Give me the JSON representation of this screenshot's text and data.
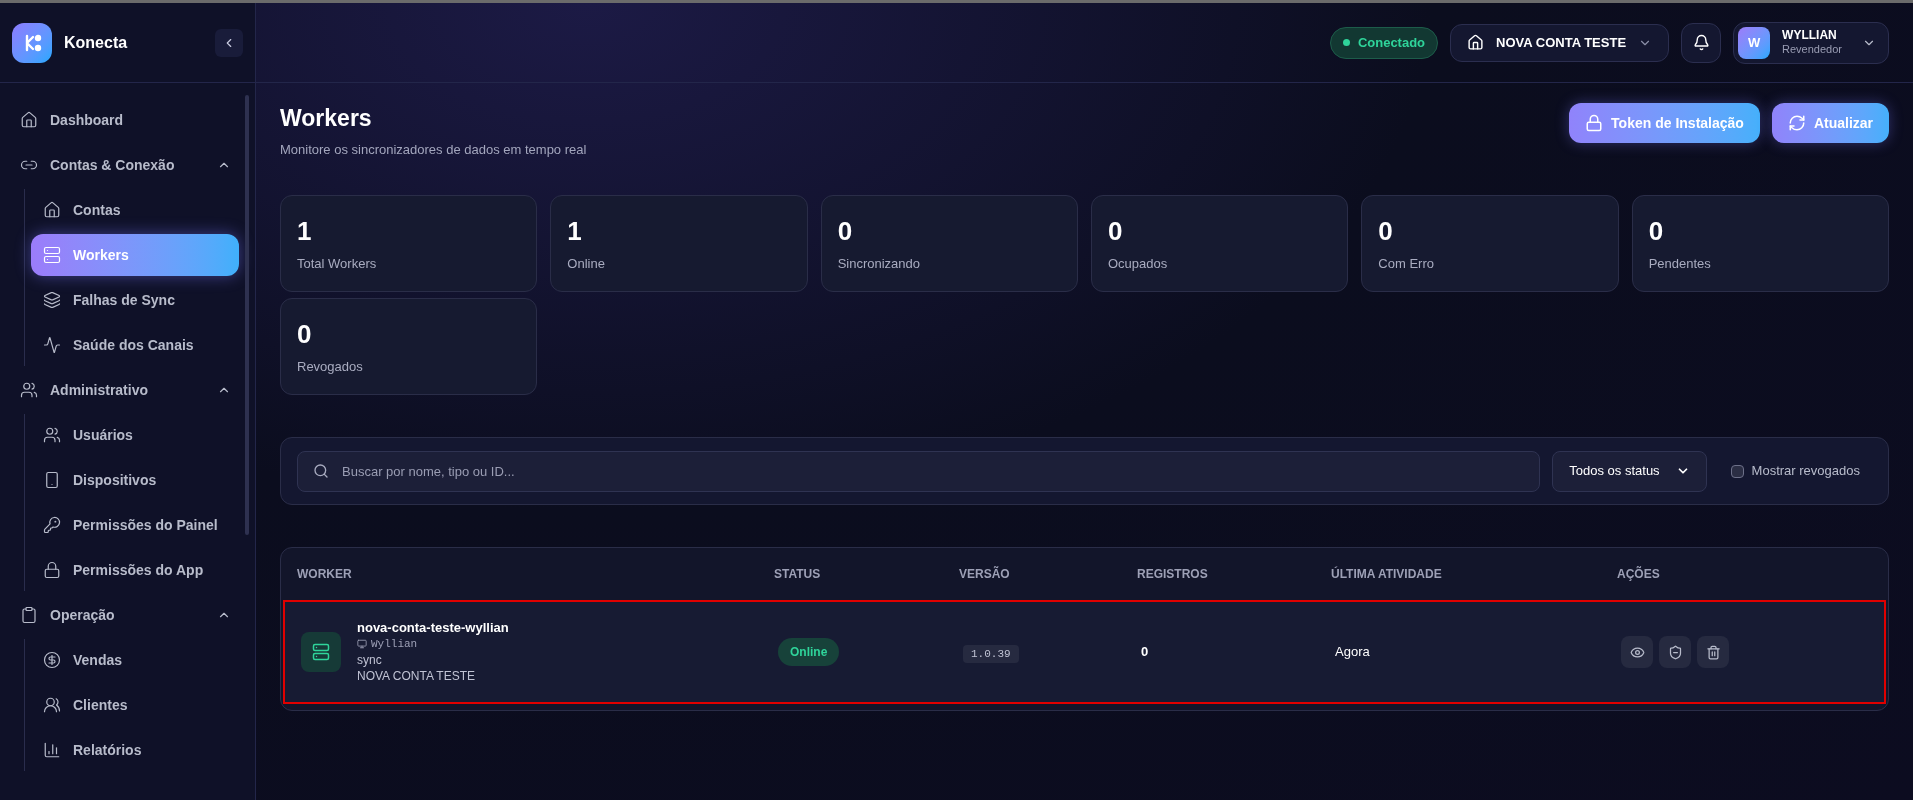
{
  "brand": {
    "name": "Konecta"
  },
  "sidebar": {
    "items": [
      {
        "label": "Dashboard",
        "selected": false
      },
      {
        "label": "Contas & Conexão",
        "expanded": true,
        "children": [
          {
            "label": "Contas",
            "selected": false
          },
          {
            "label": "Workers",
            "selected": true
          },
          {
            "label": "Falhas de Sync",
            "selected": false
          },
          {
            "label": "Saúde dos Canais",
            "selected": false
          }
        ]
      },
      {
        "label": "Administrativo",
        "expanded": true,
        "children": [
          {
            "label": "Usuários",
            "selected": false
          },
          {
            "label": "Dispositivos",
            "selected": false
          },
          {
            "label": "Permissões do Painel",
            "selected": false
          },
          {
            "label": "Permissões do App",
            "selected": false
          }
        ]
      },
      {
        "label": "Operação",
        "expanded": true,
        "children": [
          {
            "label": "Vendas",
            "selected": false
          },
          {
            "label": "Clientes",
            "selected": false
          },
          {
            "label": "Relatórios",
            "selected": false
          }
        ]
      }
    ]
  },
  "header": {
    "connection": {
      "label": "Conectado",
      "connected": true
    },
    "account": "NOVA CONTA TESTE",
    "user": {
      "initial": "W",
      "name": "WYLLIAN",
      "role": "Revendedor"
    }
  },
  "page": {
    "title": "Workers",
    "subtitle": "Monitore os sincronizadores de dados em tempo real",
    "buttons": [
      "Token de Instalação",
      "Atualizar"
    ]
  },
  "stats": [
    {
      "value": "1",
      "label": "Total Workers"
    },
    {
      "value": "1",
      "label": "Online"
    },
    {
      "value": "0",
      "label": "Sincronizando"
    },
    {
      "value": "0",
      "label": "Ocupados"
    },
    {
      "value": "0",
      "label": "Com Erro"
    },
    {
      "value": "0",
      "label": "Pendentes"
    },
    {
      "value": "0",
      "label": "Revogados"
    }
  ],
  "filters": {
    "search": {
      "placeholder": "Buscar por nome, tipo ou ID..."
    },
    "status": "Todos os status",
    "show_revoked": {
      "label": "Mostrar revogados",
      "checked": false
    }
  },
  "table": {
    "columns": [
      "WORKER",
      "STATUS",
      "VERSÃO",
      "REGISTROS",
      "ÚLTIMA ATIVIDADE",
      "AÇÕES"
    ],
    "rows": [
      {
        "name": "nova-conta-teste-wyllian",
        "host": "Wyllian",
        "type": "sync",
        "account": "NOVA CONTA TESTE",
        "status": "Online",
        "online": true,
        "version": "1.0.39",
        "records": "0",
        "last_activity": "Agora",
        "highlighted": true
      }
    ]
  }
}
